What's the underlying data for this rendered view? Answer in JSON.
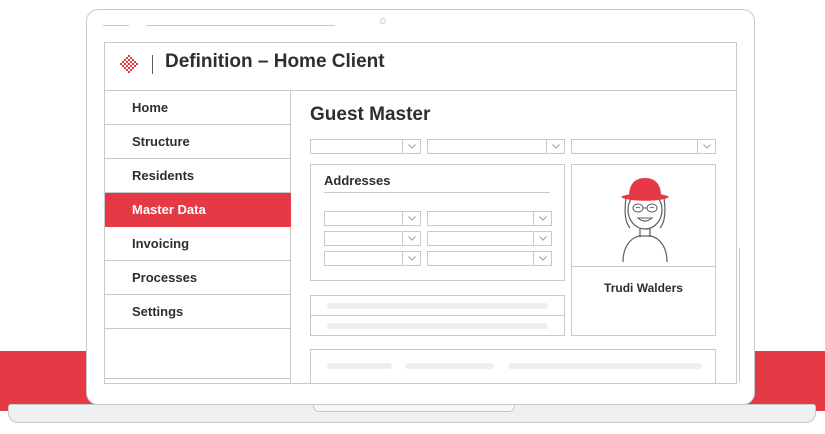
{
  "header": {
    "title": "Definition – Home Client",
    "brand_color": "#e63946"
  },
  "sidebar": {
    "items": [
      {
        "label": "Home",
        "active": false
      },
      {
        "label": "Structure",
        "active": false
      },
      {
        "label": "Residents",
        "active": false
      },
      {
        "label": "Master Data",
        "active": true
      },
      {
        "label": "Invoicing",
        "active": false
      },
      {
        "label": "Processes",
        "active": false
      },
      {
        "label": "Settings",
        "active": false
      }
    ]
  },
  "main": {
    "title": "Guest Master",
    "addresses": {
      "title": "Addresses"
    },
    "profile": {
      "name": "Trudi Walders"
    }
  },
  "icons": {
    "logo": "diamond-pixel-logo-icon",
    "chevron": "chevron-down-icon",
    "avatar": "person-avatar-icon"
  },
  "colors": {
    "accent": "#e63946",
    "border": "#c7cacd",
    "text": "#2b2e33",
    "placeholder": "#eceef0"
  }
}
